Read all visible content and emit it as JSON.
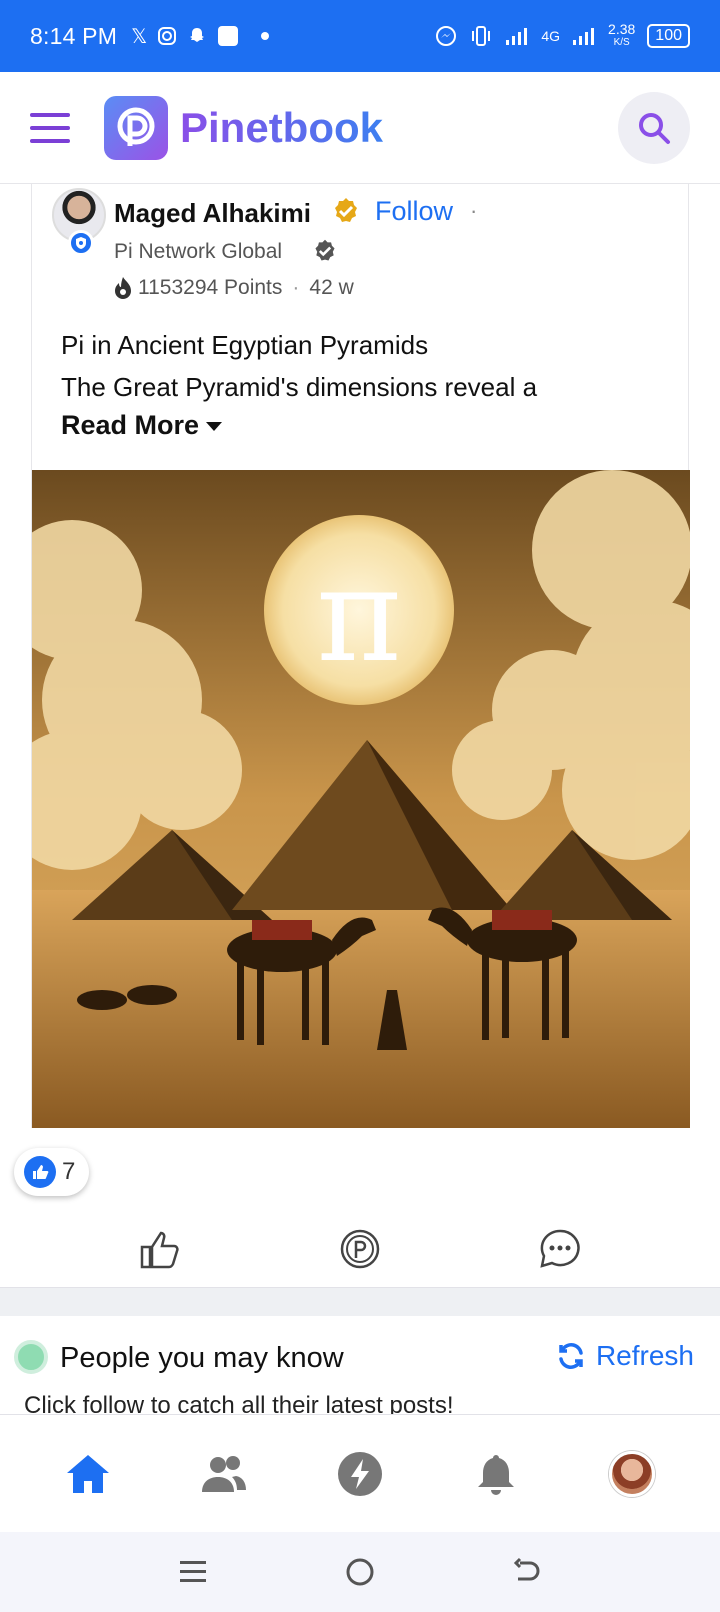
{
  "status_bar": {
    "time": "8:14 PM",
    "network_label": "4G",
    "speed_value": "2.38",
    "speed_unit": "K/S",
    "battery": "100"
  },
  "app_bar": {
    "logo_letter": "P",
    "brand": "Pinetbook"
  },
  "post": {
    "author_name": "Maged Alhakimi",
    "follow_label": "Follow",
    "separator": "·",
    "group_name": "Pi Network Global",
    "points": "1153294 Points",
    "age": "42 w",
    "text_line1": "Pi in Ancient Egyptian Pyramids",
    "text_line2": "The Great Pyramid's dimensions reveal a",
    "read_more": "Read More",
    "image_pi_symbol": "π"
  },
  "reactions": {
    "like_count": "7"
  },
  "pymk": {
    "title": "People you may know",
    "refresh_label": "Refresh",
    "subtitle": "Click follow to catch all their latest posts!"
  },
  "colors": {
    "status_bar": "#1d6ff2",
    "brand_purple": "#8a4fe8",
    "link_blue": "#1d6ff2",
    "verified_gold": "#e6a817"
  },
  "icons": {
    "menu": "hamburger-icon",
    "search": "search-icon",
    "like": "thumbs-up-icon",
    "tip": "pi-coin-icon",
    "comment": "comment-icon",
    "home": "home-icon",
    "friends": "people-icon",
    "lightning": "lightning-icon",
    "notifications": "bell-icon",
    "refresh": "refresh-icon"
  }
}
